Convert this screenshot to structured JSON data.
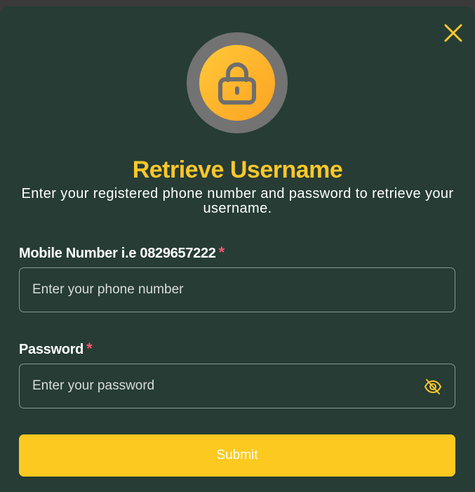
{
  "dialog": {
    "title": "Retrieve Username",
    "subtitle": "Enter your registered phone number and password to retrieve your username.",
    "close_icon": "close-icon",
    "hero_icon": "lock-icon"
  },
  "form": {
    "phone": {
      "label": "Mobile Number i.e 0829657222",
      "required_mark": "*",
      "value": "",
      "placeholder": "Enter your phone number"
    },
    "password": {
      "label": "Password",
      "required_mark": "*",
      "value": "",
      "placeholder": "Enter your password",
      "toggle_icon": "eye-off-icon"
    },
    "submit_label": "Submit"
  },
  "colors": {
    "modal_background": "#263c35",
    "accent_yellow": "#fcc72a",
    "required_red": "#f0566b",
    "lock_circle_gray": "#737373"
  }
}
